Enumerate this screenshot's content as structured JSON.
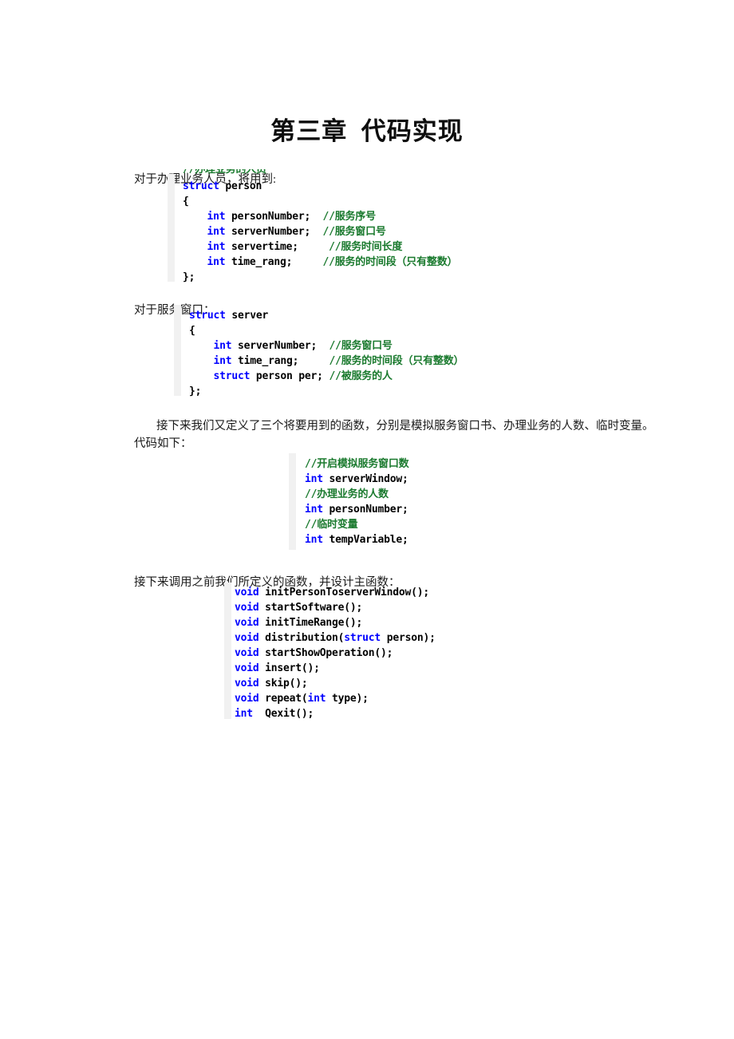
{
  "document": {
    "title": "第三章  代码实现",
    "paragraphs": {
      "intro_person": "对于办理业务人员，将用到:",
      "intro_server": "对于服务窗口：",
      "intro_functions": "接下来我们又定义了三个将要用到的函数，分别是模拟服务窗口书、办理业务的人数、临时变量。代码如下：",
      "intro_main": "接下来调用之前我们所定义的函数，并设计主函数："
    },
    "code_blocks": {
      "person_struct": {
        "clipped_top_comment": "//办理业务的人员",
        "lines": [
          [
            {
              "t": "struct",
              "c": "kw"
            },
            {
              "t": " person",
              "c": "pln"
            }
          ],
          [
            {
              "t": "{",
              "c": "pln"
            }
          ],
          [
            {
              "t": "    ",
              "c": "pln"
            },
            {
              "t": "int",
              "c": "kw"
            },
            {
              "t": " personNumber;  ",
              "c": "pln"
            },
            {
              "t": "//服务序号",
              "c": "cmt"
            }
          ],
          [
            {
              "t": "    ",
              "c": "pln"
            },
            {
              "t": "int",
              "c": "kw"
            },
            {
              "t": " serverNumber;  ",
              "c": "pln"
            },
            {
              "t": "//服务窗口号",
              "c": "cmt"
            }
          ],
          [
            {
              "t": "    ",
              "c": "pln"
            },
            {
              "t": "int",
              "c": "kw"
            },
            {
              "t": " servertime;     ",
              "c": "pln"
            },
            {
              "t": "//服务时间长度",
              "c": "cmt"
            }
          ],
          [
            {
              "t": "    ",
              "c": "pln"
            },
            {
              "t": "int",
              "c": "kw"
            },
            {
              "t": " time_rang;     ",
              "c": "pln"
            },
            {
              "t": "//服务的时间段（只有整数）",
              "c": "cmt"
            }
          ],
          [
            {
              "t": "};",
              "c": "pln"
            }
          ]
        ]
      },
      "server_struct": {
        "lines": [
          [
            {
              "t": "struct",
              "c": "kw"
            },
            {
              "t": " server",
              "c": "pln"
            }
          ],
          [
            {
              "t": "{",
              "c": "pln"
            }
          ],
          [
            {
              "t": "    ",
              "c": "pln"
            },
            {
              "t": "int",
              "c": "kw"
            },
            {
              "t": " serverNumber;  ",
              "c": "pln"
            },
            {
              "t": "//服务窗口号",
              "c": "cmt"
            }
          ],
          [
            {
              "t": "    ",
              "c": "pln"
            },
            {
              "t": "int",
              "c": "kw"
            },
            {
              "t": " time_rang;     ",
              "c": "pln"
            },
            {
              "t": "//服务的时间段（只有整数）",
              "c": "cmt"
            }
          ],
          [
            {
              "t": "    ",
              "c": "pln"
            },
            {
              "t": "struct",
              "c": "kw"
            },
            {
              "t": " person per; ",
              "c": "pln"
            },
            {
              "t": "//被服务的人",
              "c": "cmt"
            }
          ],
          [
            {
              "t": "};",
              "c": "pln"
            }
          ]
        ]
      },
      "globals": {
        "lines": [
          [
            {
              "t": "//开启模拟服务窗口数",
              "c": "cmt"
            }
          ],
          [
            {
              "t": "int",
              "c": "kw"
            },
            {
              "t": " serverWindow;",
              "c": "pln"
            }
          ],
          [
            {
              "t": "//办理业务的人数",
              "c": "cmt"
            }
          ],
          [
            {
              "t": "int",
              "c": "kw"
            },
            {
              "t": " personNumber;",
              "c": "pln"
            }
          ],
          [
            {
              "t": "//临时变量",
              "c": "cmt"
            }
          ],
          [
            {
              "t": "int",
              "c": "kw"
            },
            {
              "t": " tempVariable;",
              "c": "pln"
            }
          ]
        ]
      },
      "function_declarations": {
        "lines": [
          [
            {
              "t": "void",
              "c": "kw"
            },
            {
              "t": " initPersonToserverWindow();",
              "c": "pln"
            }
          ],
          [
            {
              "t": "void",
              "c": "kw"
            },
            {
              "t": " startSoftware();",
              "c": "pln"
            }
          ],
          [
            {
              "t": "void",
              "c": "kw"
            },
            {
              "t": " initTimeRange();",
              "c": "pln"
            }
          ],
          [
            {
              "t": "void",
              "c": "kw"
            },
            {
              "t": " distribution(",
              "c": "pln"
            },
            {
              "t": "struct",
              "c": "kw"
            },
            {
              "t": " person);",
              "c": "pln"
            }
          ],
          [
            {
              "t": "void",
              "c": "kw"
            },
            {
              "t": " startShowOperation();",
              "c": "pln"
            }
          ],
          [
            {
              "t": "void",
              "c": "kw"
            },
            {
              "t": " insert();",
              "c": "pln"
            }
          ],
          [
            {
              "t": "void",
              "c": "kw"
            },
            {
              "t": " skip();",
              "c": "pln"
            }
          ],
          [
            {
              "t": "void",
              "c": "kw"
            },
            {
              "t": " repeat(",
              "c": "pln"
            },
            {
              "t": "int",
              "c": "kw"
            },
            {
              "t": " type);",
              "c": "pln"
            }
          ],
          [
            {
              "t": "int",
              "c": "kw"
            },
            {
              "t": "  Qexit();",
              "c": "pln"
            }
          ]
        ]
      }
    },
    "colors": {
      "background": "#ffffff",
      "body_text": "#1a1a1a",
      "keyword": "#0000ff",
      "comment": "#1a7a2e",
      "code_plain": "#000000",
      "gutter": "#f1f1f1"
    }
  }
}
